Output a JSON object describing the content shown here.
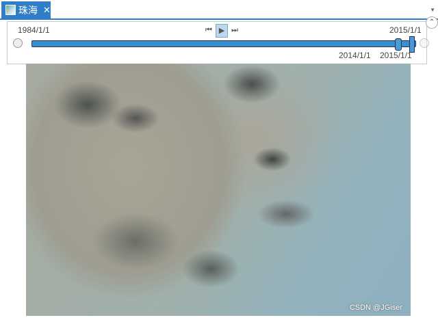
{
  "tab": {
    "title": "珠海",
    "close": "✕"
  },
  "time_slider": {
    "start_label": "1984/1/1",
    "end_label": "2015/1/1",
    "current_start": "2014/1/1",
    "current_end": "2015/1/1",
    "prev": "⏮",
    "play": "▶",
    "next": "⏭"
  },
  "map": {
    "watermark": "CSDN @JGiser"
  }
}
